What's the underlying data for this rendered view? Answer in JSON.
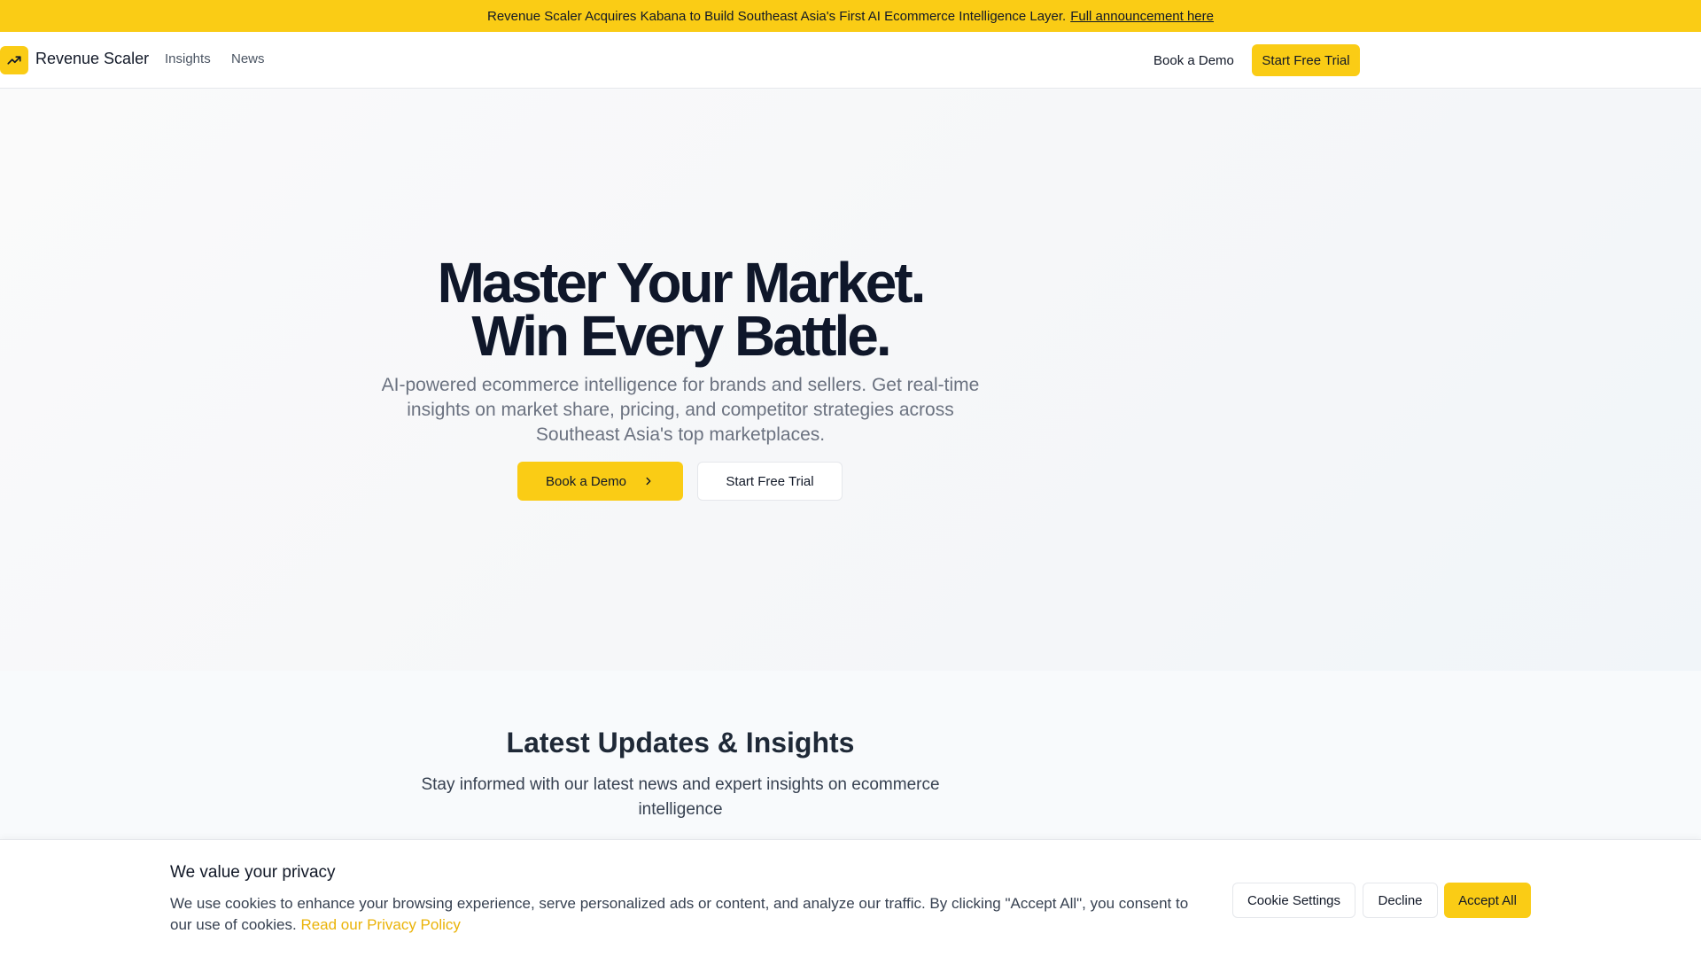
{
  "announcement": {
    "message": "Revenue Scaler Acquires Kabana to Build Southeast Asia's First AI Ecommerce Intelligence Layer.",
    "link_label": "Full announcement here"
  },
  "nav": {
    "logo_icon": "trending-up-icon",
    "brand": "Revenue Scaler",
    "links": [
      {
        "label": "Insights"
      },
      {
        "label": "News"
      }
    ],
    "demo_label": "Book a Demo",
    "trial_label": "Start Free Trial"
  },
  "hero": {
    "title_line1": "Master Your Market.",
    "title_line2": "Win Every Battle.",
    "subtitle": "AI-powered ecommerce intelligence for brands and sellers. Get real-time insights on market share, pricing, and competitor strategies across Southeast Asia's top marketplaces.",
    "demo_label": "Book a Demo",
    "trial_label": "Start Free Trial"
  },
  "updates": {
    "title": "Latest Updates & Insights",
    "subtitle": "Stay informed with our latest news and expert insights on ecommerce intelligence"
  },
  "cookie": {
    "title": "We value your privacy",
    "text": "We use cookies to enhance your browsing experience, serve personalized ads or content, and analyze our traffic. By clicking \"Accept All\", you consent to our use of cookies.",
    "policy_link": "Read our Privacy Policy",
    "settings_label": "Cookie Settings",
    "decline_label": "Decline",
    "accept_label": "Accept All"
  },
  "colors": {
    "accent": "#facc15",
    "link_accent": "#eab308",
    "text_dark": "#0f172a",
    "text_muted": "#6b7280"
  }
}
